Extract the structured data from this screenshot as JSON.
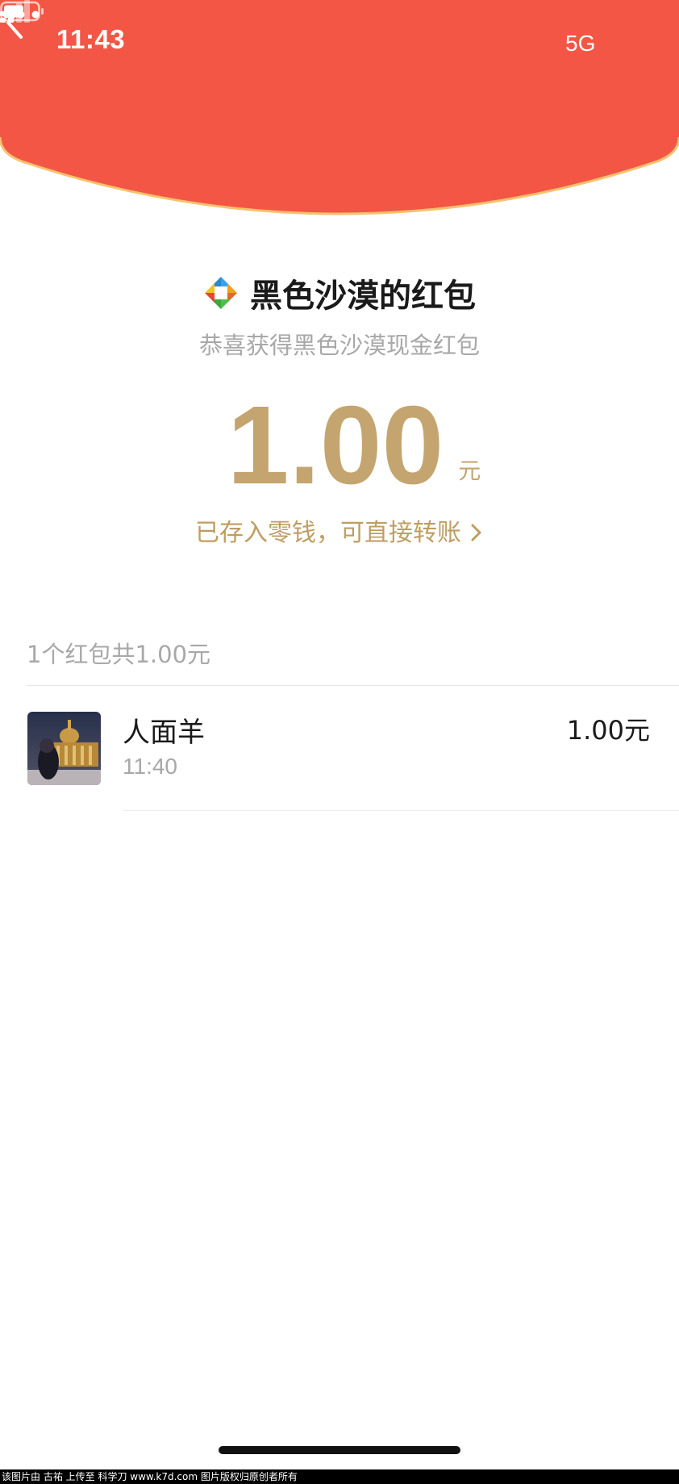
{
  "status_bar": {
    "time": "11:43",
    "network": "5G"
  },
  "header": {
    "back_icon": "chevron-left-icon",
    "more_icon": "ellipsis-icon",
    "color": "#f35645",
    "edge_color": "#f6c26e"
  },
  "envelope": {
    "title": "黑色沙漠的红包",
    "subtitle": "恭喜获得黑色沙漠现金红包",
    "amount": "1.00",
    "unit": "元",
    "deposit_text": "已存入零钱，可直接转账",
    "accent_color": "#c4a56f"
  },
  "summary": {
    "text": "1个红包共1.00元"
  },
  "records": [
    {
      "name": "人面羊",
      "time": "11:40",
      "amount": "1.00元"
    }
  ],
  "watermark": {
    "text": "该图片由 古祐 上传至 科学刀 www.k7d.com 图片版权归原创者所有"
  }
}
